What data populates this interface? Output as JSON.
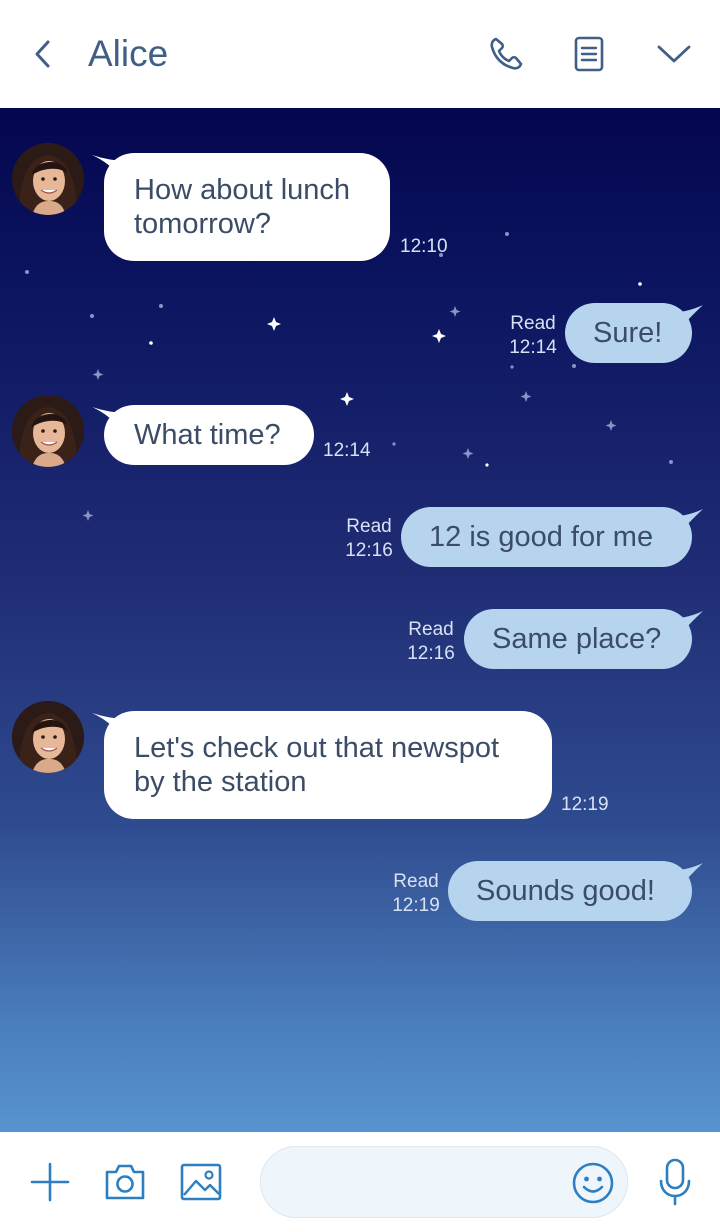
{
  "header": {
    "contact_name": "Alice",
    "icons": [
      "back-icon",
      "phone-icon",
      "notes-icon",
      "chevron-down-icon"
    ]
  },
  "messages": [
    {
      "from": "Alice",
      "direction": "in",
      "lines": [
        "How about lunch",
        "tomorrow?"
      ],
      "time": "12:10"
    },
    {
      "from": "me",
      "direction": "out",
      "text": "Sure!",
      "status": "Read",
      "time": "12:14"
    },
    {
      "from": "Alice",
      "direction": "in",
      "lines": [
        "What time?"
      ],
      "time": "12:14"
    },
    {
      "from": "me",
      "direction": "out",
      "text": "12 is good for me",
      "status": "Read",
      "time": "12:16"
    },
    {
      "from": "me",
      "direction": "out",
      "text": "Same place?",
      "status": "Read",
      "time": "12:16"
    },
    {
      "from": "Alice",
      "direction": "in",
      "lines": [
        "Let's check out that newspot",
        "by the station"
      ],
      "time": "12:19"
    },
    {
      "from": "me",
      "direction": "out",
      "text": "Sounds good!",
      "status": "Read",
      "time": "12:19"
    }
  ],
  "composer": {
    "input_value": "",
    "input_placeholder": "",
    "icons": [
      "plus-icon",
      "camera-icon",
      "image-icon",
      "emoji-icon",
      "microphone-icon"
    ]
  },
  "colors": {
    "accent": "#2d7fc1",
    "header_text": "#3f5f86",
    "outgoing_bubble": "#b6d4ee",
    "incoming_bubble": "#ffffff",
    "background_top": "#04064f",
    "background_bottom": "#5894cf"
  }
}
